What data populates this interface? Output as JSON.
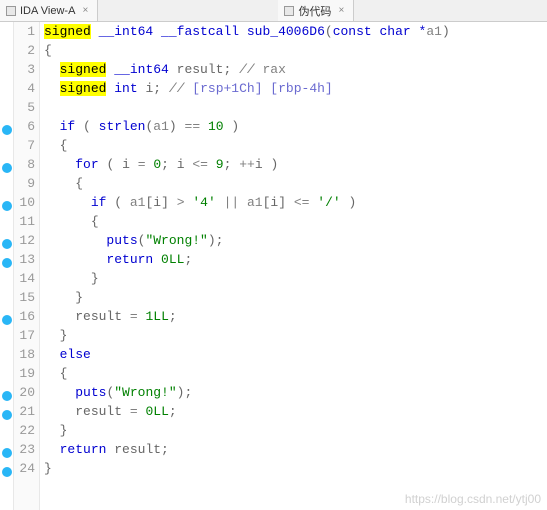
{
  "tabs": [
    {
      "label": "IDA View-A"
    },
    {
      "label": "伪代码"
    }
  ],
  "watermark": "https://blog.csdn.net/ytj00",
  "lines": [
    {
      "n": 1,
      "marker": false
    },
    {
      "n": 2,
      "marker": false
    },
    {
      "n": 3,
      "marker": false
    },
    {
      "n": 4,
      "marker": false
    },
    {
      "n": 5,
      "marker": false
    },
    {
      "n": 6,
      "marker": true
    },
    {
      "n": 7,
      "marker": false
    },
    {
      "n": 8,
      "marker": true
    },
    {
      "n": 9,
      "marker": false
    },
    {
      "n": 10,
      "marker": true
    },
    {
      "n": 11,
      "marker": false
    },
    {
      "n": 12,
      "marker": true
    },
    {
      "n": 13,
      "marker": true
    },
    {
      "n": 14,
      "marker": false
    },
    {
      "n": 15,
      "marker": false
    },
    {
      "n": 16,
      "marker": true
    },
    {
      "n": 17,
      "marker": false
    },
    {
      "n": 18,
      "marker": false
    },
    {
      "n": 19,
      "marker": false
    },
    {
      "n": 20,
      "marker": true
    },
    {
      "n": 21,
      "marker": true
    },
    {
      "n": 22,
      "marker": false
    },
    {
      "n": 23,
      "marker": true
    },
    {
      "n": 24,
      "marker": true
    }
  ],
  "t": {
    "signed": "signed",
    "int64": "__int64",
    "fastcall": "__fastcall",
    "sub": "sub_4006D6",
    "params": "const char *",
    "a1": "a1",
    "result": "result",
    "rax": "rax",
    "int": "int",
    "i": "i",
    "ireg": "[rsp+1Ch] [rbp-4h]",
    "if": "if",
    "strlen": "strlen",
    "eq10": "10",
    "for": "for",
    "zero": "0",
    "nine": "9",
    "gt": ">",
    "four": "'4'",
    "or": "||",
    "le": "<=",
    "slash": "'/'",
    "puts": "puts",
    "wrong": "\"Wrong!\"",
    "return": "return",
    "zll": "0LL",
    "one": "1LL",
    "else": "else"
  }
}
